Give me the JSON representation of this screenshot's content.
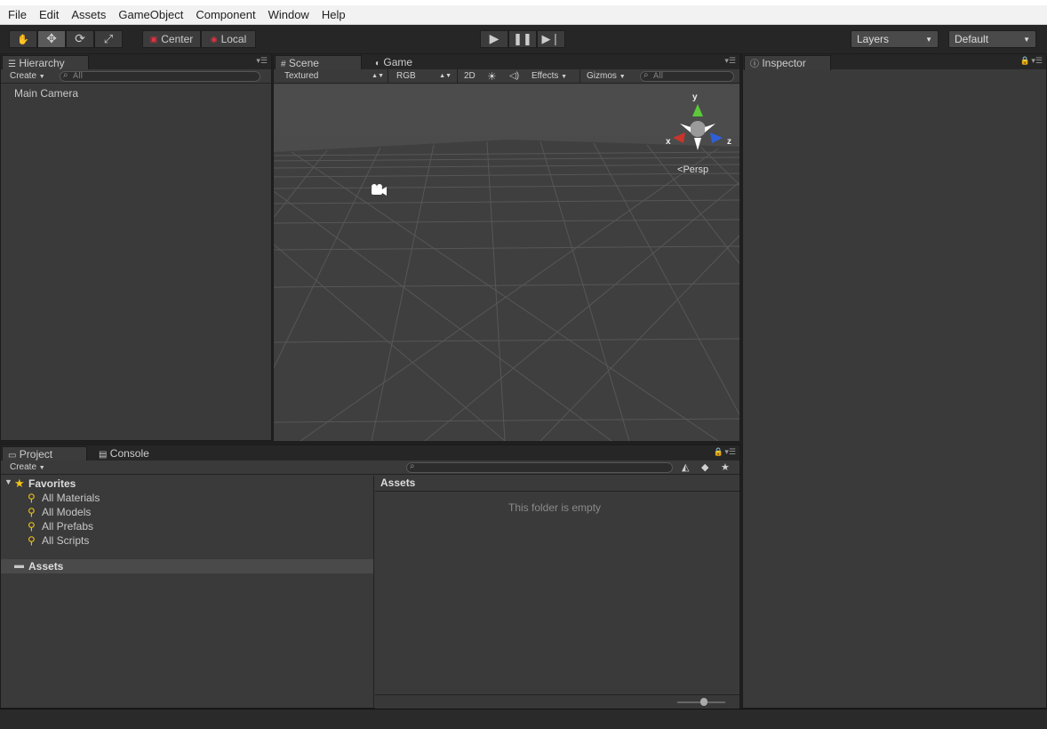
{
  "menubar": [
    "File",
    "Edit",
    "Assets",
    "GameObject",
    "Component",
    "Window",
    "Help"
  ],
  "toolbar": {
    "tools": [
      "hand-tool",
      "move-tool",
      "rotate-tool",
      "scale-tool"
    ],
    "pivot_center": "Center",
    "pivot_local": "Local",
    "layers_label": "Layers",
    "layout_label": "Default"
  },
  "hierarchy": {
    "tab": "Hierarchy",
    "create": "Create",
    "search_placeholder": "All",
    "items": [
      "Main Camera"
    ]
  },
  "scene": {
    "tab_scene": "Scene",
    "tab_game": "Game",
    "shading": "Textured",
    "render_mode": "RGB",
    "mode_2d": "2D",
    "effects": "Effects",
    "gizmos": "Gizmos",
    "search_placeholder": "All",
    "gizmo_axes": {
      "y": "y",
      "x": "x",
      "z": "z"
    },
    "projection": "Persp"
  },
  "inspector": {
    "tab": "Inspector"
  },
  "project": {
    "tab_project": "Project",
    "tab_console": "Console",
    "create": "Create",
    "favorites_label": "Favorites",
    "favorites": [
      "All Materials",
      "All Models",
      "All Prefabs",
      "All Scripts"
    ],
    "assets_label": "Assets",
    "breadcrumb": "Assets",
    "empty_message": "This folder is empty"
  },
  "colors": {
    "accent_y": "#5cc83a",
    "accent_x": "#c8352b",
    "accent_z": "#2f5fd8",
    "favorite": "#f0c419"
  }
}
